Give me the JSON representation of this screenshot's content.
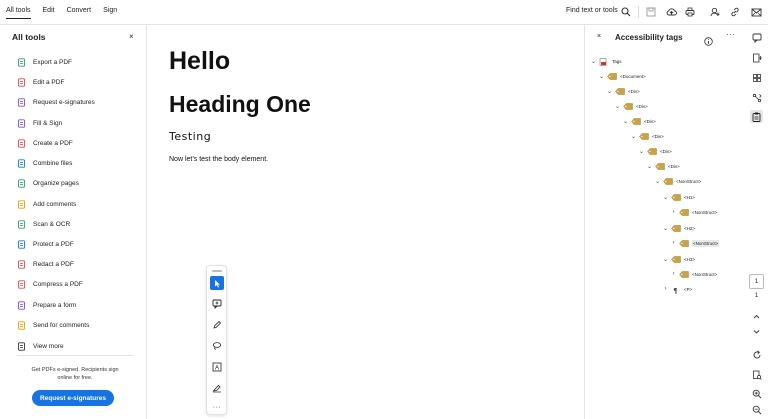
{
  "topbar": {
    "menu": [
      "All tools",
      "Edit",
      "Convert",
      "Sign"
    ],
    "find_label": "Find text or tools"
  },
  "left_panel": {
    "title": "All tools",
    "close": "×",
    "tools": [
      {
        "label": "Export a PDF",
        "icon": "export-pdf-icon",
        "color": "#2d9d78"
      },
      {
        "label": "Edit a PDF",
        "icon": "edit-pdf-icon",
        "color": "#e34850"
      },
      {
        "label": "Request e-signatures",
        "icon": "request-esign-icon",
        "color": "#7e4fcd"
      },
      {
        "label": "Fill & Sign",
        "icon": "fill-sign-icon",
        "color": "#7e4fcd"
      },
      {
        "label": "Create a PDF",
        "icon": "create-pdf-icon",
        "color": "#e34850"
      },
      {
        "label": "Combine files",
        "icon": "combine-files-icon",
        "color": "#1473e6"
      },
      {
        "label": "Organize pages",
        "icon": "organize-pages-icon",
        "color": "#2d9d78"
      },
      {
        "label": "Add comments",
        "icon": "add-comments-icon",
        "color": "#e6a100"
      },
      {
        "label": "Scan & OCR",
        "icon": "scan-ocr-icon",
        "color": "#2d9d78"
      },
      {
        "label": "Protect a PDF",
        "icon": "protect-pdf-icon",
        "color": "#1473e6"
      },
      {
        "label": "Redact a PDF",
        "icon": "redact-pdf-icon",
        "color": "#e34850"
      },
      {
        "label": "Compress a PDF",
        "icon": "compress-pdf-icon",
        "color": "#e34850"
      },
      {
        "label": "Prepare a form",
        "icon": "prepare-form-icon",
        "color": "#7e4fcd"
      },
      {
        "label": "Send for comments",
        "icon": "send-comments-icon",
        "color": "#e6a100"
      },
      {
        "label": "View more",
        "icon": "view-more-icon",
        "color": "#333333"
      }
    ],
    "promo_text": "Get PDFs e-signed. Recipients sign online for free.",
    "cta_label": "Request e-signatures"
  },
  "document": {
    "heading_title": "Hello",
    "heading_one": "Heading One",
    "heading_three": "Testing",
    "body": "Now let’s test the body element."
  },
  "tags_panel": {
    "title": "Accessibility tags",
    "close": "×",
    "more": "···",
    "nodes": [
      {
        "label": "Tags",
        "chev": "⌄",
        "icon": "tags-root-icon"
      },
      {
        "label": "<Document>",
        "chev": "⌄",
        "icon": "tag-icon"
      },
      {
        "label": "<Div>",
        "chev": "⌄",
        "icon": "tag-icon"
      },
      {
        "label": "<Div>",
        "chev": "⌄",
        "icon": "tag-icon"
      },
      {
        "label": "<Div>",
        "chev": "⌄",
        "icon": "tag-icon"
      },
      {
        "label": "<Div>",
        "chev": "⌄",
        "icon": "tag-icon"
      },
      {
        "label": "<Div>",
        "chev": "⌄",
        "icon": "tag-icon"
      },
      {
        "label": "<Div>",
        "chev": "⌄",
        "icon": "tag-icon"
      },
      {
        "label": "<NonStruct>",
        "chev": "⌄",
        "icon": "tag-icon"
      },
      {
        "label": "<H1>",
        "chev": "⌄",
        "icon": "tag-icon"
      },
      {
        "label": "<NonStruct>",
        "chev": "›",
        "icon": "tag-icon"
      },
      {
        "label": "<H2>",
        "chev": "⌄",
        "icon": "tag-icon"
      },
      {
        "label": "<NonStruct>",
        "chev": "›",
        "icon": "tag-icon",
        "highlight": true
      },
      {
        "label": "<H3>",
        "chev": "⌄",
        "icon": "tag-icon"
      },
      {
        "label": "<NonStruct>",
        "chev": "›",
        "icon": "tag-icon"
      },
      {
        "label": "<P>",
        "chev": "›",
        "icon": "paragraph-icon"
      }
    ]
  },
  "rail": {
    "page_box": "1",
    "page_num": "1"
  },
  "colors": {
    "accent": "#1473e6",
    "tag_gold": "#c9a441"
  }
}
